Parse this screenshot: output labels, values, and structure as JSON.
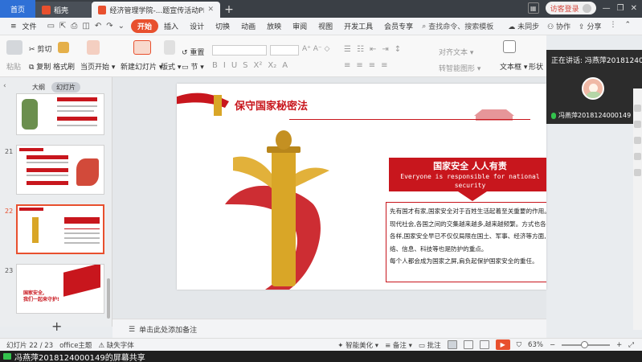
{
  "tabs": {
    "home": "首页",
    "docer": "稻壳",
    "active_doc": "经济管理学院-...题宣传活动PPT",
    "add": "+"
  },
  "window": {
    "login": "访客登录"
  },
  "menu": {
    "file": "文件",
    "items": [
      "开始",
      "插入",
      "设计",
      "切换",
      "动画",
      "放映",
      "审阅",
      "视图",
      "开发工具",
      "会员专享"
    ],
    "search": "查找命令、搜索模板",
    "right": [
      "未同步",
      "协作",
      "分享"
    ]
  },
  "ribbon": {
    "paste": "粘贴",
    "cut": "剪切",
    "copy": "复制",
    "format_painter": "格式刷",
    "play_from_current": "当页开始",
    "new_slide": "新建幻灯片",
    "layout": "版式",
    "section": "节",
    "reset": "重置",
    "align_text": "对齐文本",
    "convert_smartart": "转智能图形",
    "textbox": "文本框",
    "shape": "形状"
  },
  "share": {
    "title": "正在讲话: 冯燕萍2018124001...",
    "user": "冯燕萍2018124000149"
  },
  "thumbs": {
    "tab_outline": "大纲",
    "tab_slides": "幻灯片",
    "slides": [
      {
        "num": "",
        "caption": ""
      },
      {
        "num": "21",
        "caption": ""
      },
      {
        "num": "22",
        "caption": ""
      },
      {
        "num": "23",
        "caption": "国家安全,\n我们一起来守护!"
      }
    ],
    "add": "+"
  },
  "slide": {
    "title": "保守国家秘密法",
    "callout_cn": "国家安全  人人有责",
    "callout_en": "Everyone is responsible for national security",
    "paragraphs": [
      "先有国才有家,国家安全对于百姓生活起着至关重要的作用。",
      "现代社会,各国之间的交集越来越多,越来越频繁。方式也各种各样,国家安全早已不仅仅局限在国土、军事、经济等方面,网络、信息、科技等也是防护的重点。",
      "每个人都会成为国家之屏,肩负起保护国家安全的重任。"
    ]
  },
  "notes": {
    "placeholder": "单击此处添加备注"
  },
  "status": {
    "slide_count": "幻灯片 22 / 23",
    "theme": "office主题",
    "missing_font": "缺失字体",
    "beautify": "智能美化",
    "notes": "备注",
    "comments": "批注",
    "zoom": "63%"
  },
  "banner": {
    "text": "冯燕萍2018124000149的屏幕共享"
  },
  "colors": {
    "accent": "#e8502e",
    "slide_red": "#c8161d"
  }
}
